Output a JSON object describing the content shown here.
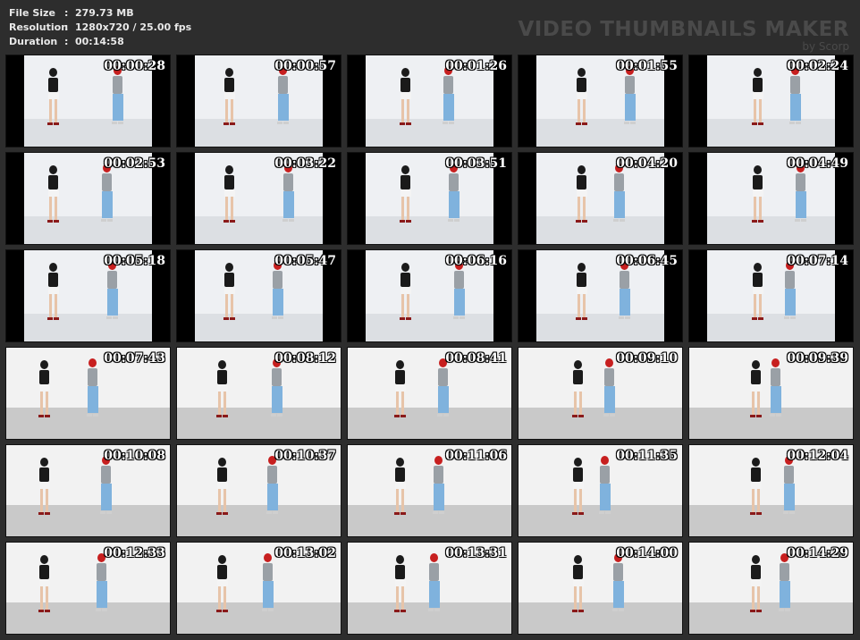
{
  "info": {
    "file_size_label": "File Size",
    "file_size": "279.73 MB",
    "resolution_label": "Resolution",
    "resolution": "1280x720 / 25.00 fps",
    "duration_label": "Duration",
    "duration": "00:14:58",
    "separator": ":"
  },
  "brand": {
    "title": "VIDEO THUMBNAILS MAKER",
    "subtitle": "by Scorp"
  },
  "thumbnails": [
    {
      "time": "00:00:28",
      "style": "pb"
    },
    {
      "time": "00:00:57",
      "style": "pb"
    },
    {
      "time": "00:01:26",
      "style": "pb"
    },
    {
      "time": "00:01:55",
      "style": "pb"
    },
    {
      "time": "00:02:24",
      "style": "pb"
    },
    {
      "time": "00:02:53",
      "style": "pb"
    },
    {
      "time": "00:03:22",
      "style": "pb"
    },
    {
      "time": "00:03:51",
      "style": "pb"
    },
    {
      "time": "00:04:20",
      "style": "pb"
    },
    {
      "time": "00:04:49",
      "style": "pb"
    },
    {
      "time": "00:05:18",
      "style": "pb"
    },
    {
      "time": "00:05:47",
      "style": "pb"
    },
    {
      "time": "00:06:16",
      "style": "pb"
    },
    {
      "time": "00:06:45",
      "style": "pb"
    },
    {
      "time": "00:07:14",
      "style": "pb"
    },
    {
      "time": "00:07:43",
      "style": "hd"
    },
    {
      "time": "00:08:12",
      "style": "hd"
    },
    {
      "time": "00:08:41",
      "style": "hd"
    },
    {
      "time": "00:09:10",
      "style": "hd"
    },
    {
      "time": "00:09:39",
      "style": "hd"
    },
    {
      "time": "00:10:08",
      "style": "hd"
    },
    {
      "time": "00:10:37",
      "style": "hd"
    },
    {
      "time": "00:11:06",
      "style": "hd"
    },
    {
      "time": "00:11:35",
      "style": "hd"
    },
    {
      "time": "00:12:04",
      "style": "hd"
    },
    {
      "time": "00:12:33",
      "style": "hd"
    },
    {
      "time": "00:13:02",
      "style": "hd"
    },
    {
      "time": "00:13:31",
      "style": "hd"
    },
    {
      "time": "00:14:00",
      "style": "hd"
    },
    {
      "time": "00:14:29",
      "style": "hd"
    }
  ]
}
